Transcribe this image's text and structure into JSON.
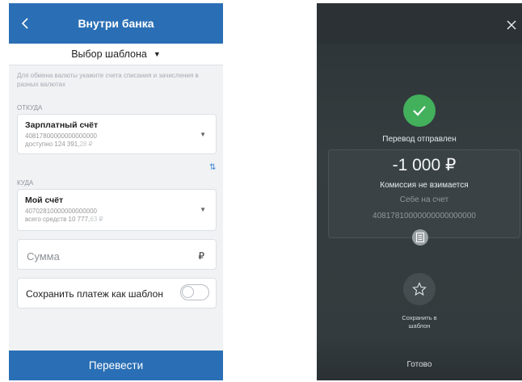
{
  "left": {
    "header": {
      "title": "Внутри банка"
    },
    "template_selector": {
      "label": "Выбор шаблона"
    },
    "hint": "Для обмена валюты укажите счета списания и зачисления в разных валютах",
    "from": {
      "section_label": "ОТКУДА",
      "account_name": "Зарплатный счёт",
      "account_number": "40817800000000000000",
      "balance_prefix": "доступно 124 391,",
      "balance_cents": "28 ₽"
    },
    "to": {
      "section_label": "КУДА",
      "account_name": "Мой счёт",
      "account_number": "40702810000000000000",
      "balance_prefix": "всего средств 10 777,",
      "balance_cents": "63 ₽"
    },
    "amount": {
      "placeholder": "Сумма",
      "currency": "₽"
    },
    "save_template": {
      "label": "Сохранить платеж как шаблон",
      "enabled": false
    },
    "submit_label": "Перевести"
  },
  "right": {
    "status": "Перевод отправлен",
    "amount": "-1 000 ₽",
    "fee": "Комиссия не взимается",
    "destination": "Себе на счет",
    "account": "40817810000000000000000",
    "save_template_line1": "Сохранить в",
    "save_template_line2": "шаблон",
    "done_label": "Готово"
  },
  "colors": {
    "header_blue": "#2a6fb5",
    "success_green": "#43b05c",
    "dark_bg": "#343b3e"
  }
}
